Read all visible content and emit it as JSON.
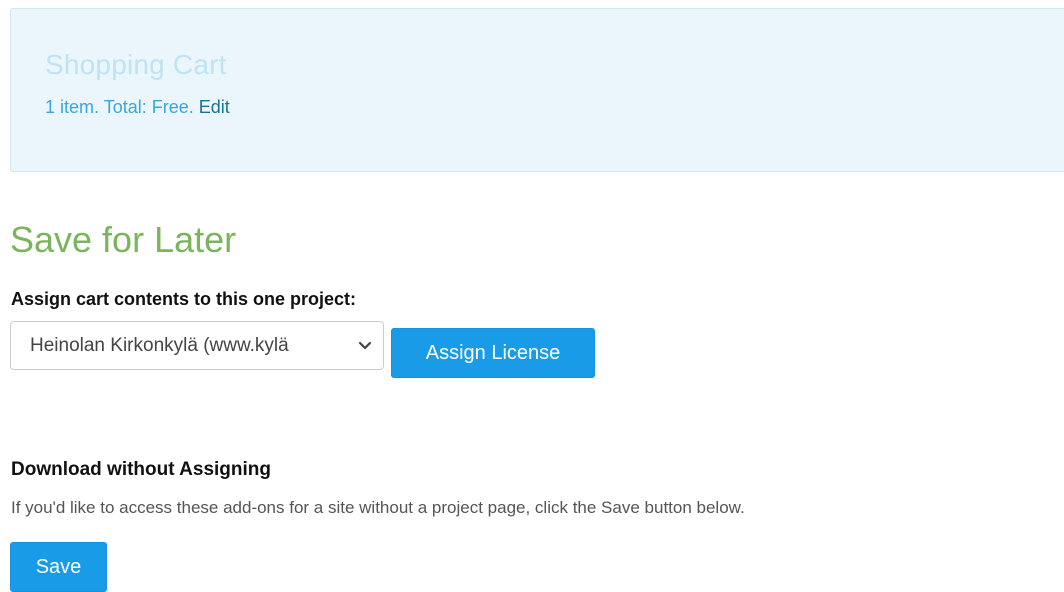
{
  "cart": {
    "title": "Shopping Cart",
    "summary": "1 item. Total: Free.",
    "edit_label": "Edit"
  },
  "save_for_later": {
    "title": "Save for Later",
    "assign_label": "Assign cart contents to this one project:",
    "project_select": {
      "selected": "Heinolan Kirkonkylä (www.kylä"
    },
    "assign_button_label": "Assign License"
  },
  "download": {
    "heading": "Download without Assigning",
    "description": "If you'd like to access these add-ons for a site without a project page, click the Save button below.",
    "save_button_label": "Save"
  },
  "colors": {
    "accent_blue": "#1a9be8",
    "section_green": "#7ab55c",
    "cart_panel_bg": "#eaf6fc"
  }
}
